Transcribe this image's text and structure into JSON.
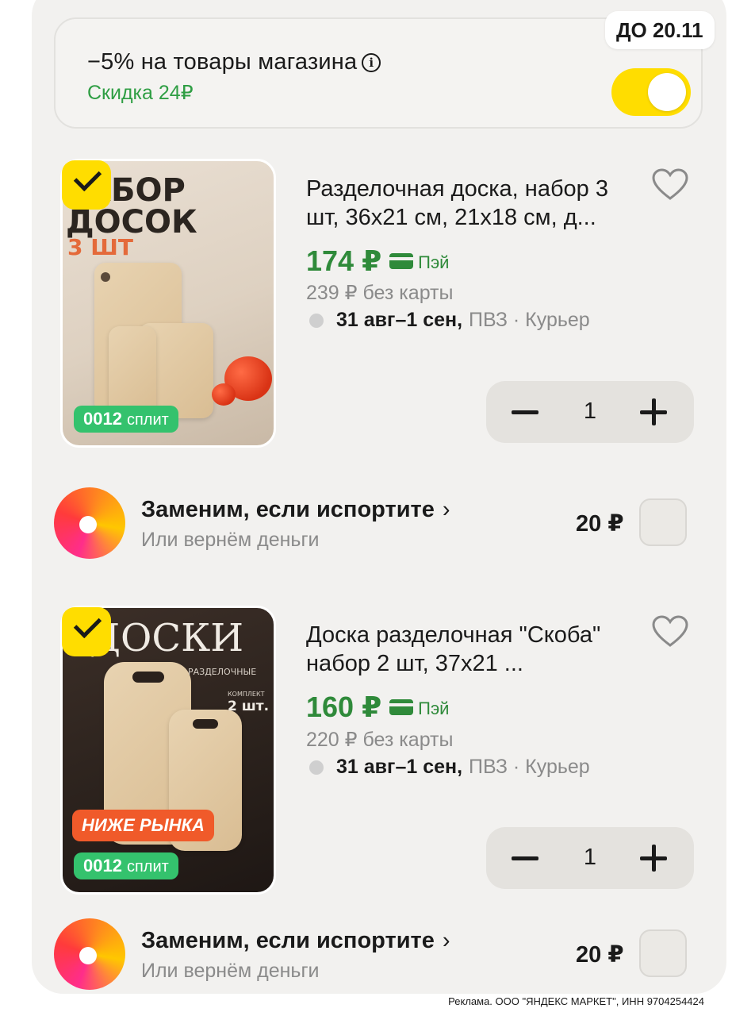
{
  "discount": {
    "title": "−5% на товары магазина",
    "subtitle": "Скидка 24₽",
    "deadline": "ДО 20.11",
    "enabled": true
  },
  "products": [
    {
      "title": "Разделочная доска, набор 3 шт, 36х21 см, 21х18 см, д...",
      "price": "174 ₽",
      "pay_label": "Пэй",
      "old_price": "239 ₽ без карты",
      "delivery_dates": "31 авг–1 сен,",
      "delivery_methods": "ПВЗ · Курьер",
      "quantity": "1",
      "selected": true,
      "split_amount": "0012",
      "split_word": "сплит",
      "image_text": {
        "line1": "АБОР",
        "line2": "ДОСОК",
        "line3": "3 ШТ"
      }
    },
    {
      "title": "Доска разделочная \"Скоба\" набор 2 шт, 37х21 ...",
      "price": "160 ₽",
      "pay_label": "Пэй",
      "old_price": "220 ₽ без карты",
      "delivery_dates": "31 авг–1 сен,",
      "delivery_methods": "ПВЗ · Курьер",
      "quantity": "1",
      "selected": true,
      "split_amount": "0012",
      "split_word": "сплит",
      "promo": "НИЖЕ РЫНКА",
      "image_text": {
        "line1": "ДОСКИ",
        "line2": "РАЗДЕЛОЧНЫЕ",
        "line3": "КОМПЛЕКТ",
        "line4": "2 шт."
      }
    }
  ],
  "insurance": {
    "title": "Заменим, если испортите",
    "chevron": "›",
    "subtitle": "Или вернём деньги",
    "price": "20 ₽"
  },
  "footer": {
    "ad_note": "Реклама. ООО \"ЯНДЕКС МАРКЕТ\", ИНН 9704254424"
  },
  "colors": {
    "accent_yellow": "#ffdd00",
    "price_green": "#2f8a3a",
    "discount_green": "#2f9e44",
    "split_green": "#34c26d",
    "promo_orange": "#f05a2a"
  }
}
